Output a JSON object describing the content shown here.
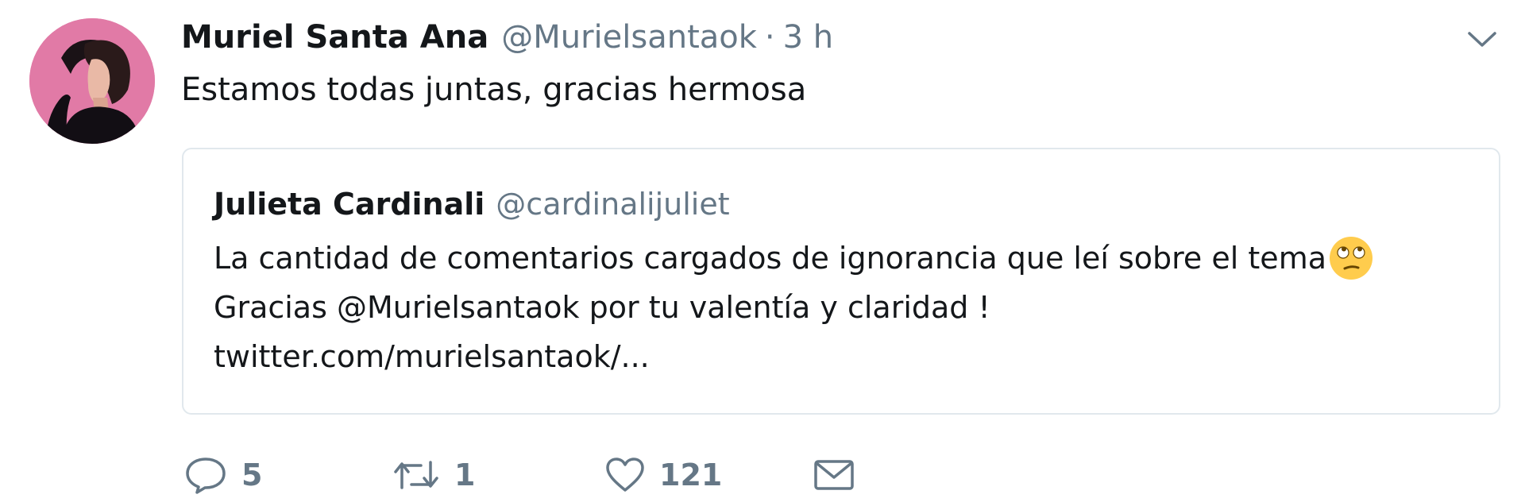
{
  "tweet": {
    "author": {
      "display_name": "Muriel Santa Ana",
      "handle": "@Murielsantaok",
      "avatar_icon": "profile-photo"
    },
    "separator": "·",
    "timestamp": "3 h",
    "text": "Estamos todas juntas, gracias hermosa",
    "menu_icon": "chevron-down-icon"
  },
  "quoted_tweet": {
    "display_name": "Julieta Cardinali",
    "handle": "@cardinalijuliet",
    "lines": [
      "La cantidad de comentarios cargados de ignorancia que leí sobre el tema",
      "Gracias @Murielsantaok por tu valentía y claridad !",
      "twitter.com/murielsantaok/..."
    ],
    "emoji_icon": "face-with-rolling-eyes"
  },
  "actions": {
    "reply": {
      "icon": "reply-icon",
      "count": "5"
    },
    "retweet": {
      "icon": "retweet-icon",
      "count": "1"
    },
    "like": {
      "icon": "heart-icon",
      "count": "121"
    },
    "direct_message": {
      "icon": "envelope-icon"
    }
  },
  "colors": {
    "text_primary": "#14171a",
    "text_secondary": "#657786",
    "border": "#e1e8ed",
    "avatar_bg": "#e17aa6"
  }
}
